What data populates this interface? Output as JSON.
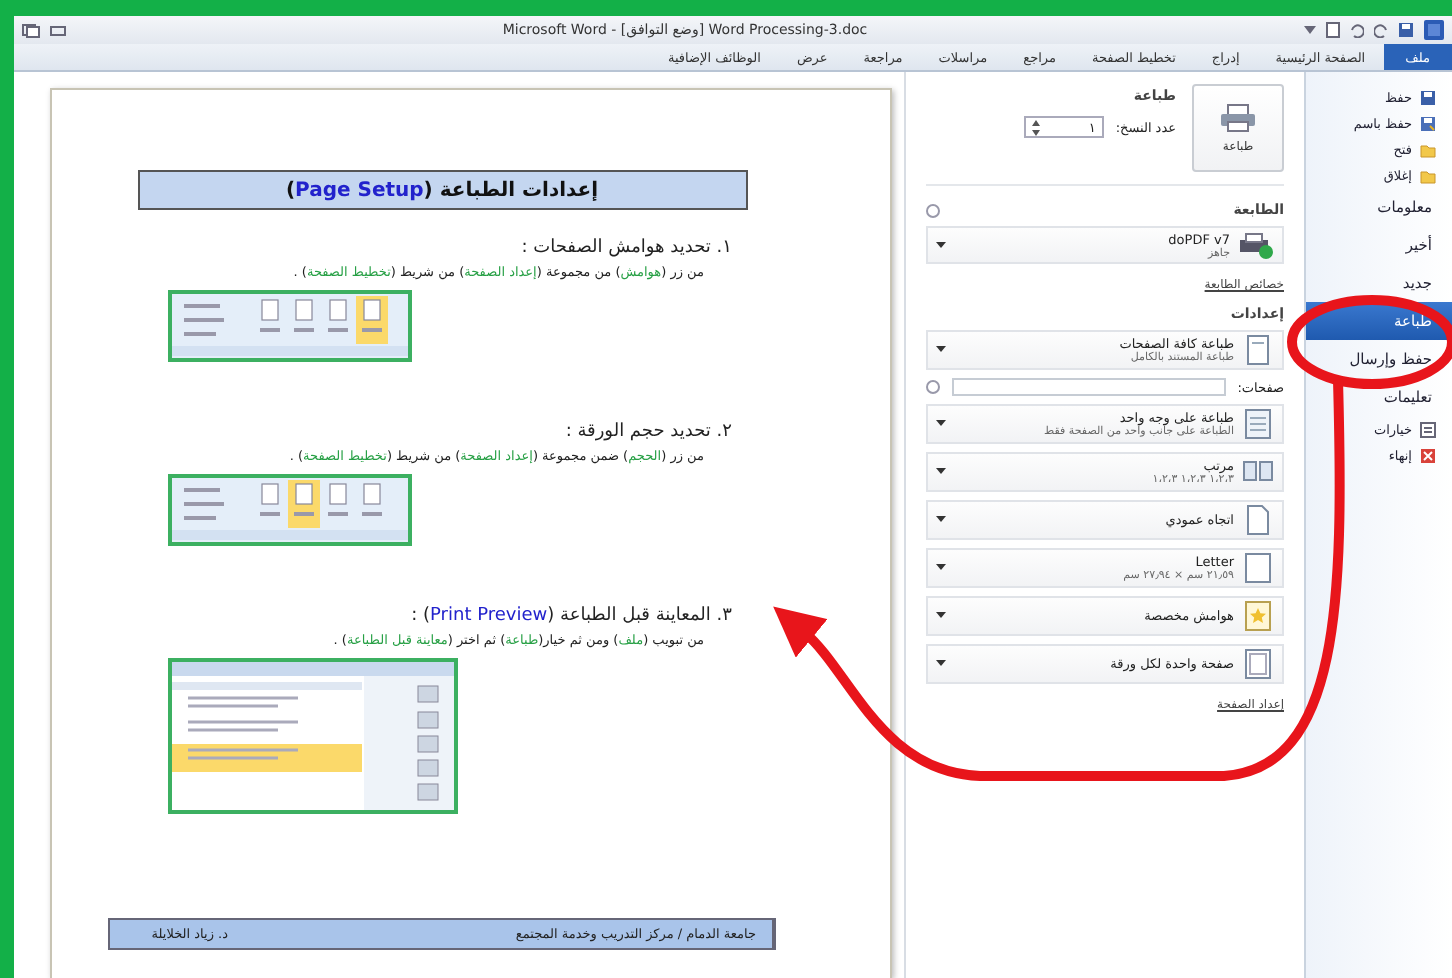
{
  "window": {
    "title": "Microsoft Word - [وضع التوافق] Word Processing-3.doc"
  },
  "ribbon_tabs": [
    {
      "label": "ملف",
      "selected": true
    },
    {
      "label": "الصفحة الرئيسية",
      "selected": false
    },
    {
      "label": "إدراج",
      "selected": false
    },
    {
      "label": "تخطيط الصفحة",
      "selected": false
    },
    {
      "label": "مراجع",
      "selected": false
    },
    {
      "label": "مراسلات",
      "selected": false
    },
    {
      "label": "مراجعة",
      "selected": false
    },
    {
      "label": "عرض",
      "selected": false
    },
    {
      "label": "الوظائف الإضافية",
      "selected": false
    }
  ],
  "backstage_menu": [
    {
      "label": "حفظ",
      "kind": "command",
      "selected": false
    },
    {
      "label": "حفظ باسم",
      "kind": "command",
      "selected": false
    },
    {
      "label": "فتح",
      "kind": "command",
      "selected": false
    },
    {
      "label": "إغلاق",
      "kind": "command",
      "selected": false
    },
    {
      "label": "معلومات",
      "kind": "section",
      "selected": false
    },
    {
      "label": "أخير",
      "kind": "section",
      "selected": false
    },
    {
      "label": "جديد",
      "kind": "section",
      "selected": false
    },
    {
      "label": "طباعة",
      "kind": "section",
      "selected": true
    },
    {
      "label": "حفظ وإرسال",
      "kind": "section",
      "selected": false
    },
    {
      "label": "تعليمات",
      "kind": "section",
      "selected": false
    },
    {
      "label": "خيارات",
      "kind": "command",
      "selected": false
    },
    {
      "label": "إنهاء",
      "kind": "command",
      "selected": false
    }
  ],
  "print": {
    "heading": "طباعة",
    "copies_label": "عدد النسخ:",
    "copies": "١",
    "print_button": "طباعة",
    "printer_heading": "الطابعة",
    "printer": {
      "name": "doPDF v7",
      "status": "جاهز"
    },
    "printer_properties": "خصائص الطابعة",
    "settings_heading": "إعدادات",
    "settings": [
      {
        "kind": "dropdown",
        "title": "طباعة كافة الصفحات",
        "subtitle": "طباعة المستند بالكامل"
      },
      {
        "kind": "field",
        "label": "صفحات:"
      },
      {
        "kind": "dropdown",
        "title": "طباعة على وجه واحد",
        "subtitle": "الطباعة على جانب واحد من الصفحة فقط"
      },
      {
        "kind": "dropdown",
        "title": "مرتب",
        "subtitle": "١،٢،٣    ١،٢،٣    ١،٢،٣"
      },
      {
        "kind": "dropdown",
        "title": "اتجاه عمودي"
      },
      {
        "kind": "dropdown",
        "title": "Letter",
        "subtitle": "٢١٫٥٩ سم × ٢٧٫٩٤ سم"
      },
      {
        "kind": "dropdown",
        "title": "هوامش مخصصة"
      },
      {
        "kind": "dropdown",
        "title": "صفحة واحدة لكل ورقة"
      }
    ],
    "page_setup_link": "إعداد الصفحة"
  },
  "document": {
    "title": [
      {
        "kind": "text",
        "text": "إعدادات الطباعة ("
      },
      {
        "kind": "english",
        "text": "Page Setup"
      },
      {
        "kind": "text",
        "text": ")"
      }
    ],
    "sections": [
      {
        "heading": [
          {
            "kind": "text",
            "text": "١. تحديد هوامش الصفحات :"
          }
        ],
        "body": [
          {
            "kind": "text",
            "text": "من زر ("
          },
          {
            "kind": "term",
            "text": "هوامش"
          },
          {
            "kind": "text",
            "text": ") من مجموعة ("
          },
          {
            "kind": "term",
            "text": "إعداد الصفحة"
          },
          {
            "kind": "text",
            "text": ") من شريط ("
          },
          {
            "kind": "term",
            "text": "تخطيط الصفحة"
          },
          {
            "kind": "text",
            "text": ") ."
          }
        ],
        "figure": {
          "kind": "ribbon",
          "tools": [
            {
              "selected": true
            },
            {
              "selected": false
            },
            {
              "selected": false
            },
            {
              "selected": false
            }
          ]
        }
      },
      {
        "heading": [
          {
            "kind": "text",
            "text": "٢. تحديد حجم الورقة :"
          }
        ],
        "body": [
          {
            "kind": "text",
            "text": "من زر ("
          },
          {
            "kind": "term",
            "text": "الحجم"
          },
          {
            "kind": "text",
            "text": ") ضمن مجموعة ("
          },
          {
            "kind": "term",
            "text": "إعداد الصفحة"
          },
          {
            "kind": "text",
            "text": ") من شريط ("
          },
          {
            "kind": "term",
            "text": "تخطيط الصفحة"
          },
          {
            "kind": "text",
            "text": ") ."
          }
        ],
        "figure": {
          "kind": "ribbon",
          "tools": [
            {
              "selected": false
            },
            {
              "selected": false
            },
            {
              "selected": true
            },
            {
              "selected": false
            }
          ]
        }
      },
      {
        "heading": [
          {
            "kind": "text",
            "text": "٣. المعاينة قبل الطباعة ("
          },
          {
            "kind": "english",
            "text": "Print Preview"
          },
          {
            "kind": "text",
            "text": ") :"
          }
        ],
        "body": [
          {
            "kind": "text",
            "text": "من تبويب ("
          },
          {
            "kind": "term",
            "text": "ملف"
          },
          {
            "kind": "text",
            "text": ") ومن ثم خيار("
          },
          {
            "kind": "term",
            "text": "طباعة"
          },
          {
            "kind": "text",
            "text": ") ثم اختر ("
          },
          {
            "kind": "term",
            "text": "معاينة قبل الطباعة"
          },
          {
            "kind": "text",
            "text": ") ."
          }
        ],
        "figure": {
          "kind": "menu"
        }
      }
    ],
    "footer": {
      "institution": "جامعة الدمام / مركز التدريب وخدمة المجتمع",
      "author": "د. زياد الخلايلة"
    }
  }
}
